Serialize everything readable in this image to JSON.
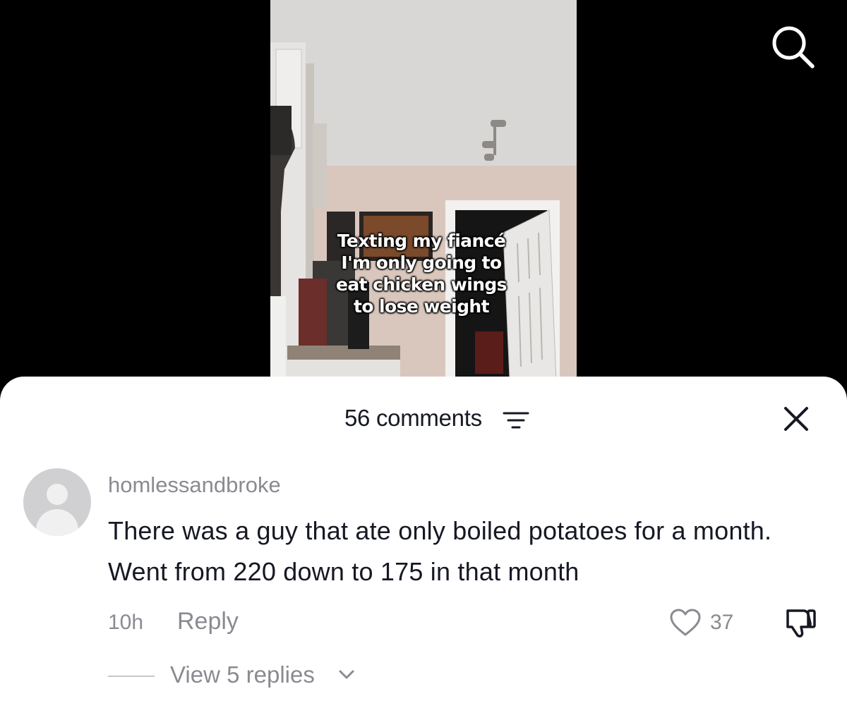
{
  "video": {
    "caption": "Texting my fiancé\nI'm only going to\neat chicken wings\nto lose weight"
  },
  "header": {
    "search_icon": "search-icon"
  },
  "sheet": {
    "comments_count": "56 comments",
    "sort_icon": "sort-lines-icon",
    "close_icon": "close-icon"
  },
  "comments": [
    {
      "username": "homlessandbroke",
      "text": "There was a guy that ate only boiled potatoes for a month. Went from 220 down to 175 in that month",
      "timestamp": "10h",
      "reply_label": "Reply",
      "likes": "37",
      "view_replies": "View 5 replies"
    }
  ],
  "colors": {
    "sheet_bg": "#ffffff",
    "primary_text": "#161823",
    "secondary_text": "#8a8b91",
    "page_bg": "#000000"
  }
}
